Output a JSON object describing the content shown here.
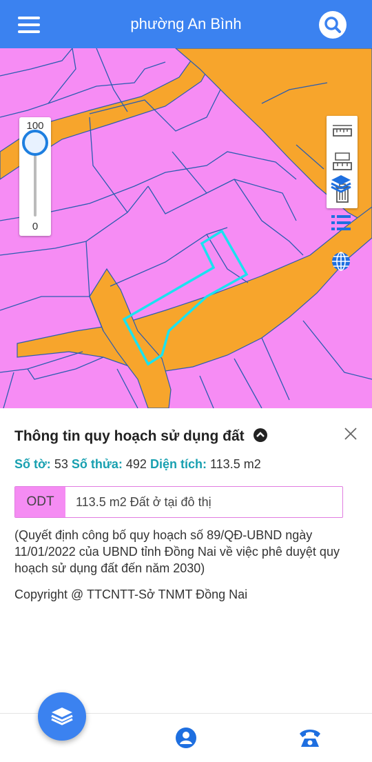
{
  "header": {
    "title": "phường An Bình",
    "menu_icon": "menu-icon",
    "search_icon": "search-icon",
    "color": "#3b82f0"
  },
  "map": {
    "land_color": "#f68cf4",
    "road_color": "#f7a52c",
    "boundary_color": "#2a5db0",
    "highlight_color": "#19e3f0",
    "opacity_slider": {
      "max_label": "100",
      "min_label": "0",
      "value": 100
    },
    "tools": [
      "measure-distance-icon",
      "measure-area-icon",
      "trash-icon"
    ],
    "floating_buttons": [
      "layers-icon",
      "list-icon",
      "globe-icon"
    ]
  },
  "info": {
    "title": "Thông tin quy hoạch sử dụng đất",
    "toggle_icon": "chevron-up-circle-icon",
    "close_icon": "close-icon",
    "sheet_label": "Số tờ:",
    "sheet_value": "53",
    "parcel_label": "Số thửa:",
    "parcel_value": "492",
    "area_label": "Diện tích:",
    "area_value": "113.5 m2",
    "use_code": "ODT",
    "use_desc": "113.5 m2 Đất ở tại đô thị",
    "decision": "(Quyết định công bố quy hoạch số 89/QĐ-UBND ngày 11/01/2022 của UBND tỉnh Đồng Nai về việc phê duyệt quy hoạch sử dụng đất đến năm 2030)",
    "copyright": "Copyright @ TTCNTT-Sở TNMT Đồng Nai"
  },
  "bottom_nav": {
    "fab_icon": "layers-icon",
    "items": [
      "user-icon",
      "phone-icon"
    ]
  }
}
